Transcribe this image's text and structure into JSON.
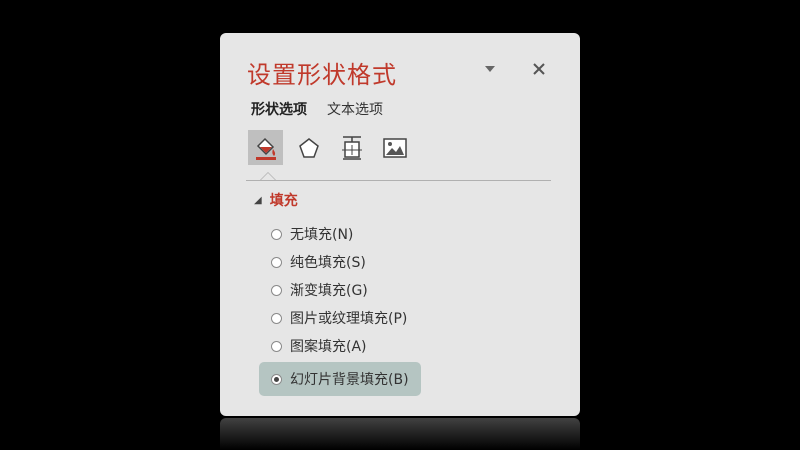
{
  "panel": {
    "title": "设置形状格式",
    "tabs": [
      {
        "label": "形状选项",
        "active": true
      },
      {
        "label": "文本选项",
        "active": false
      }
    ],
    "icons": [
      "fill-line-icon",
      "effects-pentagon-icon",
      "size-properties-icon",
      "picture-icon"
    ],
    "section": {
      "label": "填充",
      "expanded": true,
      "options": [
        {
          "label": "无填充(N)",
          "checked": false
        },
        {
          "label": "纯色填充(S)",
          "checked": false
        },
        {
          "label": "渐变填充(G)",
          "checked": false
        },
        {
          "label": "图片或纹理填充(P)",
          "checked": false
        },
        {
          "label": "图案填充(A)",
          "checked": false
        },
        {
          "label": "幻灯片背景填充(B)",
          "checked": true
        }
      ]
    }
  },
  "colors": {
    "accent": "#c0392b",
    "panel_bg": "#e6e6e6",
    "selected_option_bg": "#b5c5c2"
  }
}
